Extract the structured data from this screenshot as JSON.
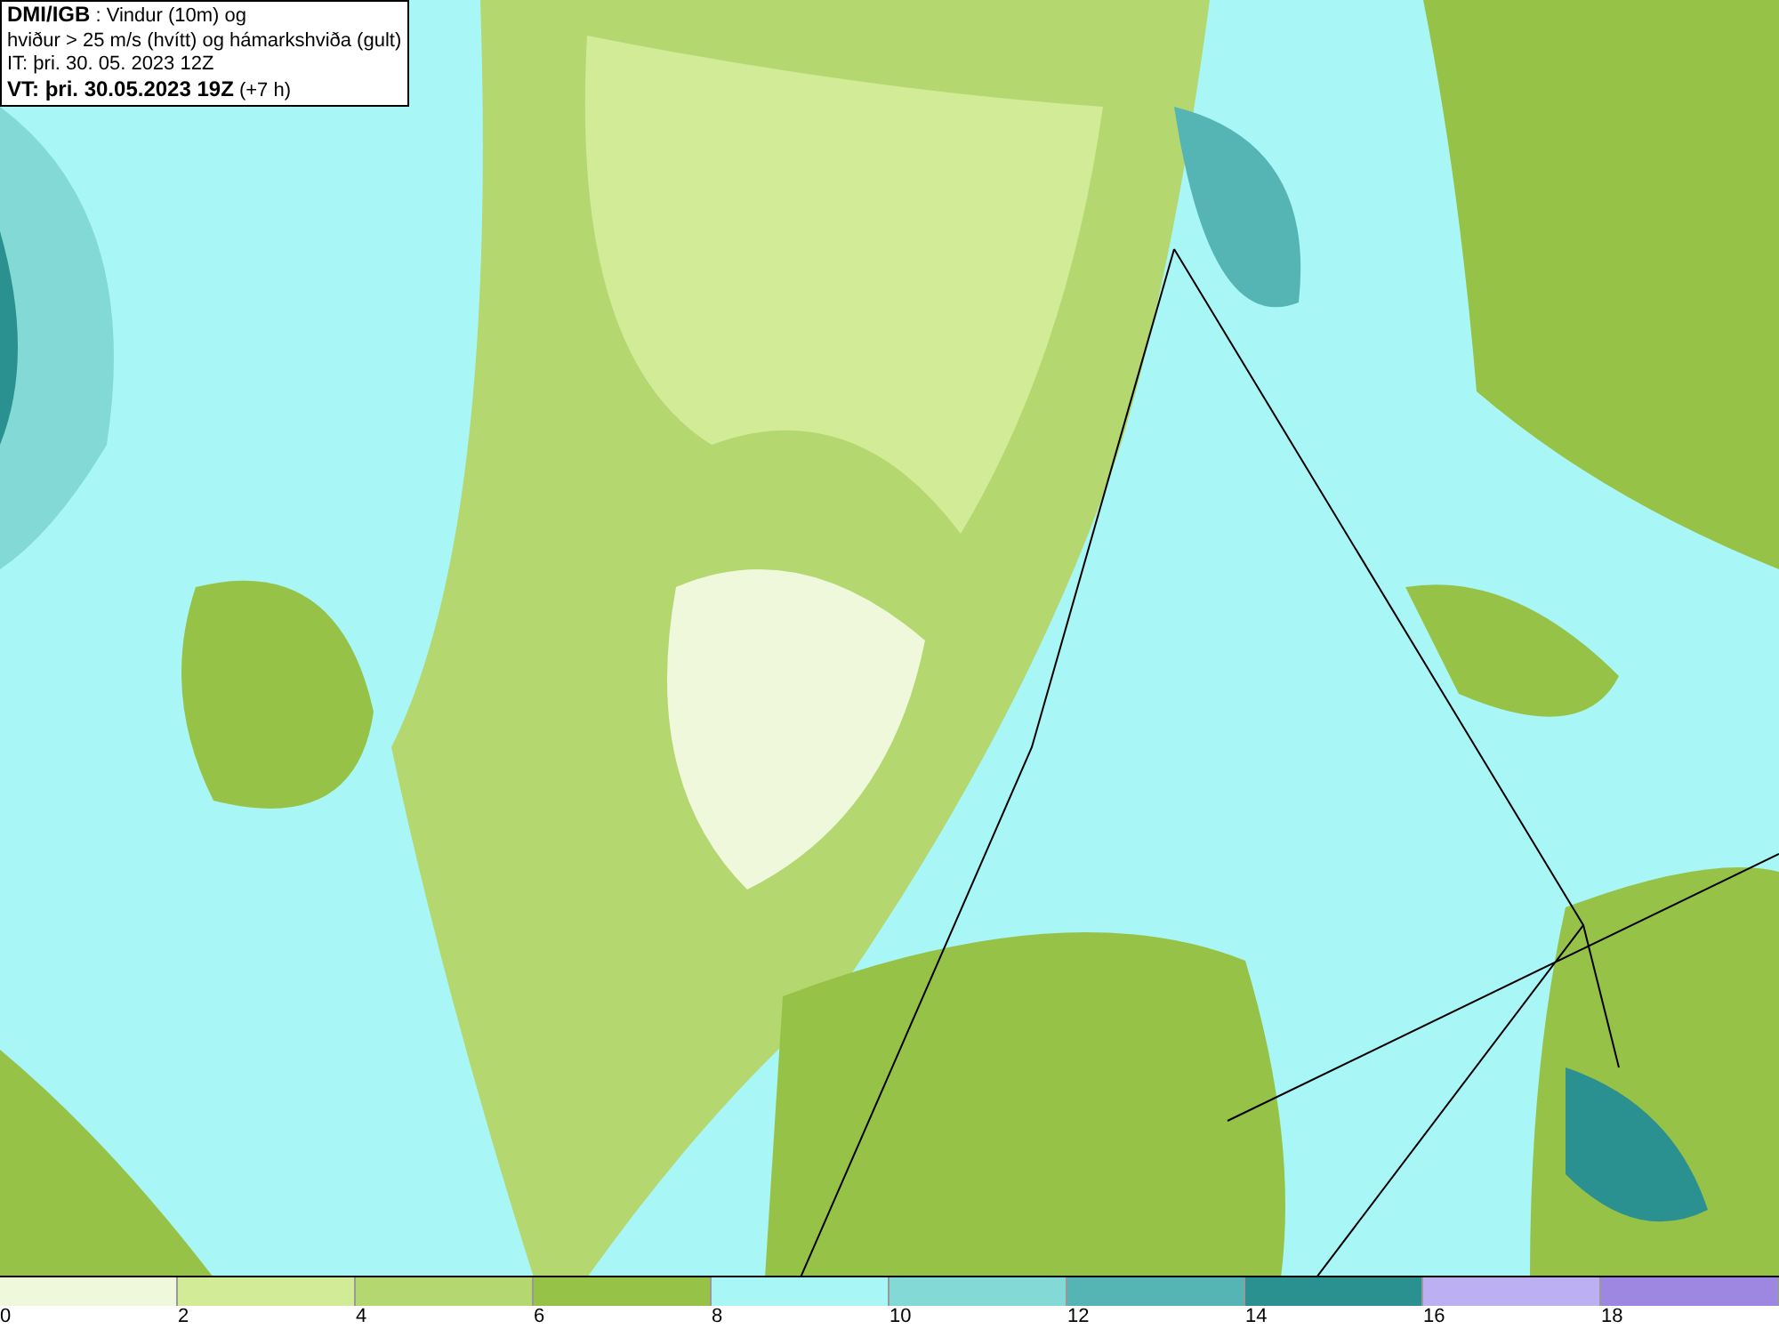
{
  "title_lines": [
    "**DMI/IGB** : Vindur (10m) og",
    "hviður > 25 m/s (hvítt) og hámarkshviða (gult)",
    "IT: þri. 30. 05. 2023 12Z",
    "**VT: þri. 30.05.2023 19Z** (+7 h)"
  ],
  "legend": {
    "bands": [
      {
        "color": "#f0f8dc"
      },
      {
        "color": "#d2eb96"
      },
      {
        "color": "#b4d770"
      },
      {
        "color": "#96c347"
      },
      {
        "color": "#a8f7f6"
      },
      {
        "color": "#82d9d6"
      },
      {
        "color": "#55b5b5"
      },
      {
        "color": "#2a9190"
      },
      {
        "color": "#bcb0f2"
      },
      {
        "color": "#9d87e0"
      }
    ],
    "ticks": [
      "0",
      "2",
      "4",
      "6",
      "8",
      "10",
      "12",
      "14",
      "16",
      "18"
    ]
  }
}
